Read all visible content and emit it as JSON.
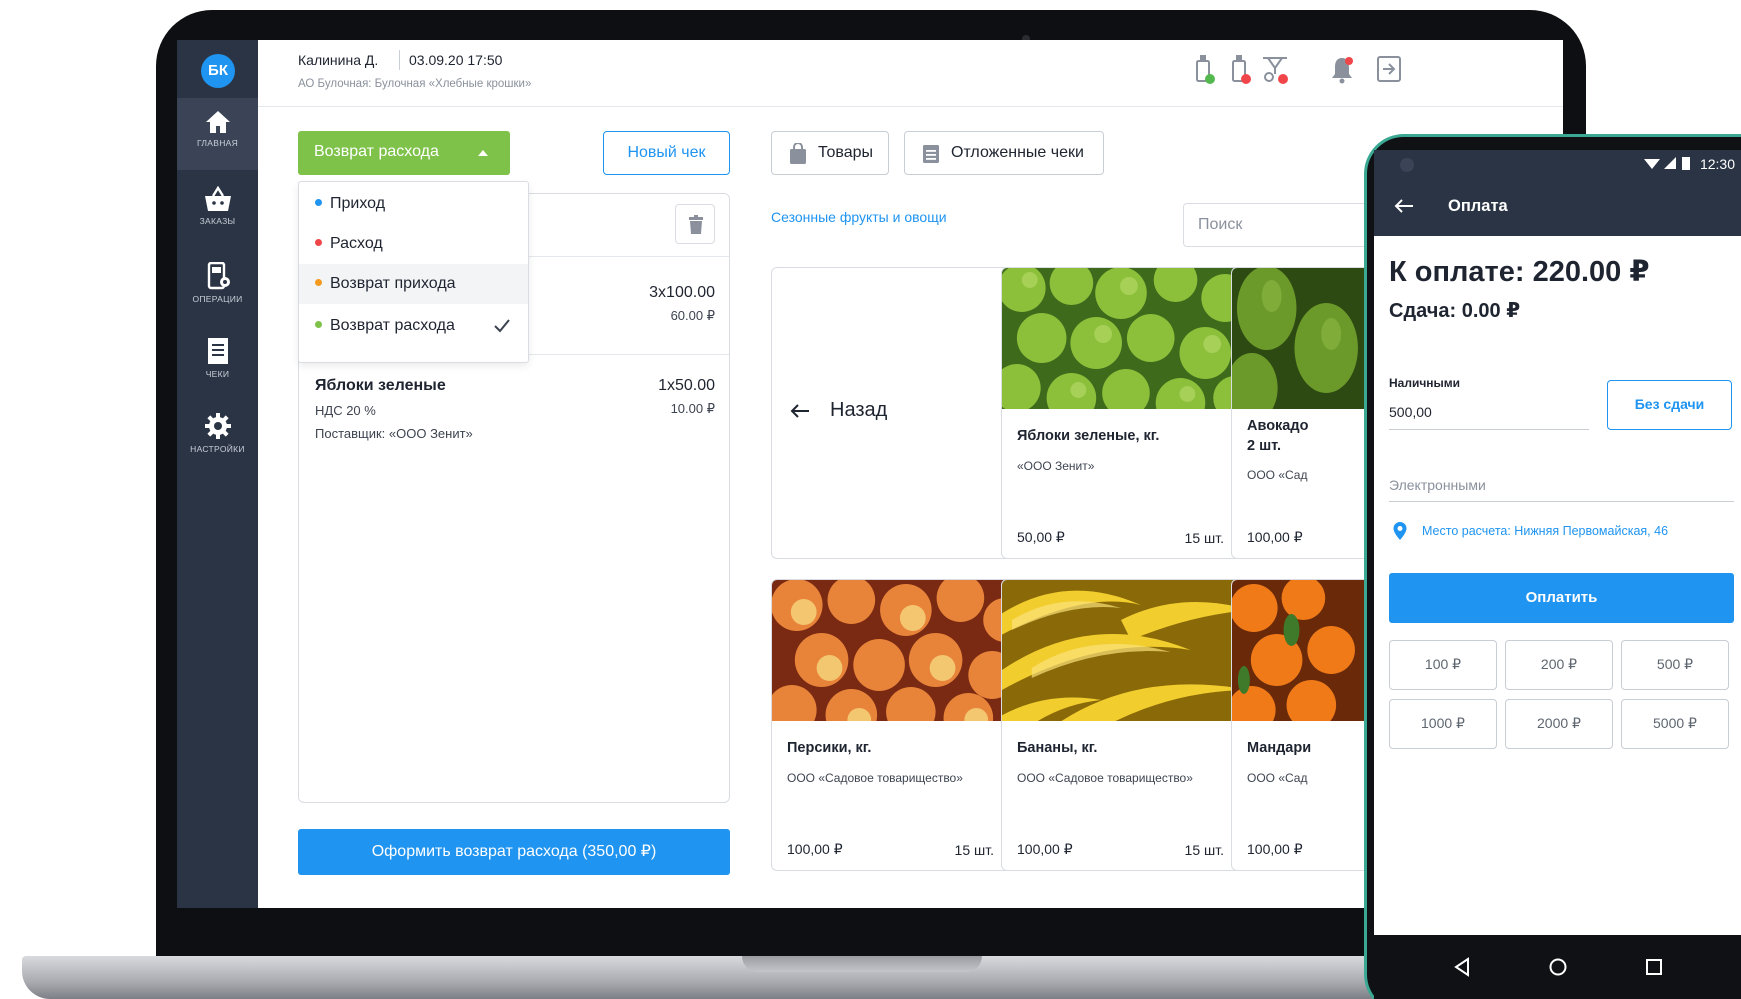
{
  "header": {
    "user": "Калинина Д.",
    "datetime": "03.09.20 17:50",
    "org": "АО Булочная: Булочная «Хлебные крошки»"
  },
  "sidebar": {
    "logo": "БК",
    "items": [
      {
        "label": "ГЛАВНАЯ",
        "icon": "home-icon"
      },
      {
        "label": "ЗАКАЗЫ",
        "icon": "basket-icon"
      },
      {
        "label": "ОПЕРАЦИИ",
        "icon": "operations-icon"
      },
      {
        "label": "ЧЕКИ",
        "icon": "receipt-icon"
      },
      {
        "label": "НАСТРОЙКИ",
        "icon": "gear-icon"
      }
    ]
  },
  "left": {
    "type_button": "Возврат расхода",
    "new_receipt": "Новый чек",
    "dropdown": [
      {
        "label": "Приход",
        "color": "#1f94f0"
      },
      {
        "label": "Расход",
        "color": "#f0464a"
      },
      {
        "label": "Возврат прихода",
        "color": "#f39a1f"
      },
      {
        "label": "Возврат расхода",
        "color": "#7ec24a"
      }
    ],
    "items": [
      {
        "qty": "3x100.00",
        "sum": "60.00 ₽"
      },
      {
        "name": "Яблоки зеленые",
        "qty": "1x50.00",
        "vat": "НДС 20 %",
        "sum": "10.00 ₽",
        "supplier": "Поставщик: «ООО Зенит»"
      }
    ],
    "submit": "Оформить возврат расхода (350,00 ₽)"
  },
  "catalog": {
    "tabs": [
      "Товары",
      "Отложенные чеки"
    ],
    "category": "Сезонные фрукты и овощи",
    "search_placeholder": "Поиск",
    "back": "Назад",
    "cards": [
      {
        "title": "Яблоки зеленые, кг.",
        "supplier": "«ООО Зенит»",
        "price": "50,00 ₽",
        "stock": "15 шт."
      },
      {
        "title": "Авокадо",
        "title2": "2 шт.",
        "supplier": "ООО «Сад",
        "price": "100,00 ₽",
        "stock": ""
      },
      {
        "title": "Персики, кг.",
        "supplier": "ООО «Садовое товарищество»",
        "price": "100,00 ₽",
        "stock": "15 шт."
      },
      {
        "title": "Бананы, кг.",
        "supplier": "ООО «Садовое товарищество»",
        "price": "100,00 ₽",
        "stock": "15 шт."
      },
      {
        "title": "Мандари",
        "supplier": "ООО «Сад",
        "price": "100,00 ₽",
        "stock": ""
      }
    ]
  },
  "phone": {
    "time": "12:30",
    "title": "Оплата",
    "total": "К оплате: 220.00 ₽",
    "change": "Сдача: 0.00 ₽",
    "cash_label": "Наличными",
    "cash_value": "500,00",
    "no_change": "Без сдачи",
    "electronic_label": "Электронными",
    "place": "Место расчета: Нижняя Первомайская, 46",
    "pay": "Оплатить",
    "amounts": [
      "100 ₽",
      "200 ₽",
      "500 ₽",
      "1000 ₽",
      "2000 ₽",
      "5000 ₽"
    ]
  }
}
